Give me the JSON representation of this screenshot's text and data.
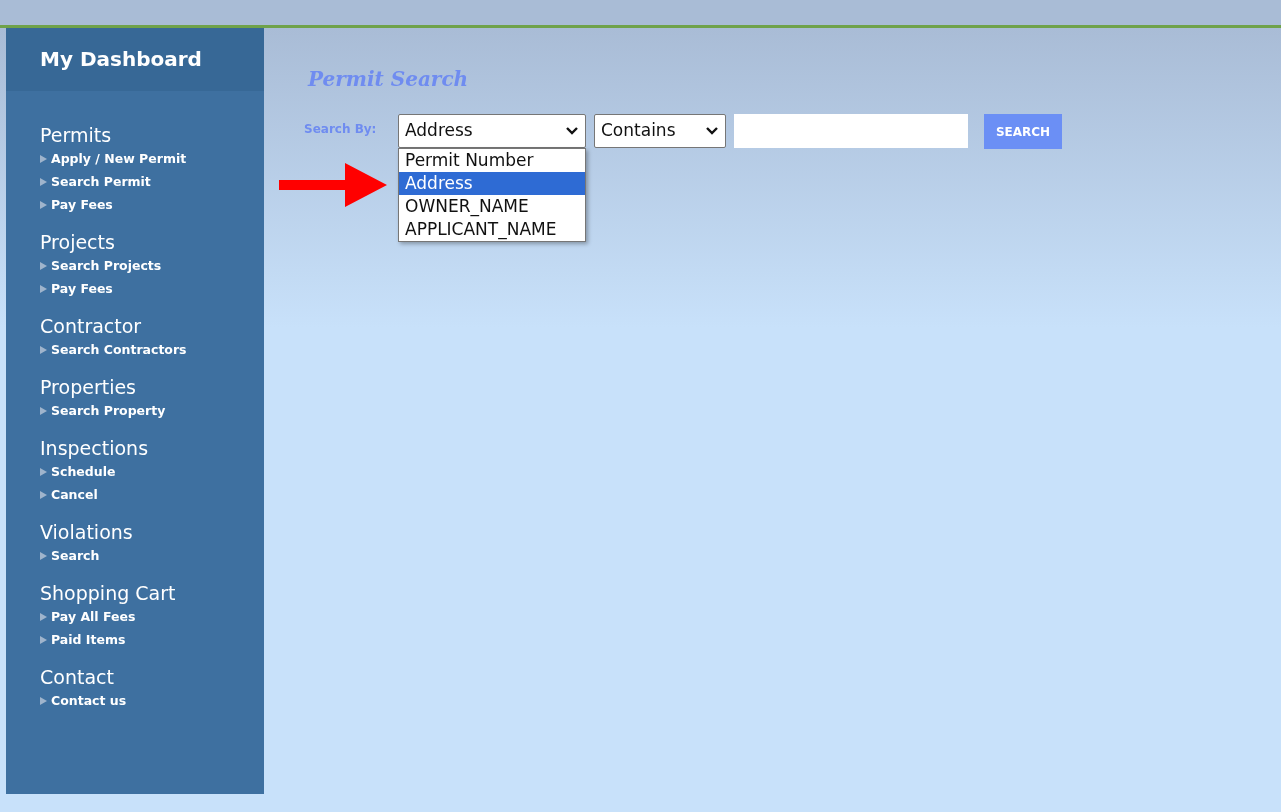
{
  "sidebar": {
    "title": "My Dashboard",
    "sections": [
      {
        "heading": "Permits",
        "items": [
          "Apply / New Permit",
          "Search Permit",
          "Pay Fees"
        ]
      },
      {
        "heading": "Projects",
        "items": [
          "Search Projects",
          "Pay Fees"
        ]
      },
      {
        "heading": "Contractor",
        "items": [
          "Search Contractors"
        ]
      },
      {
        "heading": "Properties",
        "items": [
          "Search Property"
        ]
      },
      {
        "heading": "Inspections",
        "items": [
          "Schedule",
          "Cancel"
        ]
      },
      {
        "heading": "Violations",
        "items": [
          "Search"
        ]
      },
      {
        "heading": "Shopping Cart",
        "items": [
          "Pay All Fees",
          "Paid Items"
        ]
      },
      {
        "heading": "Contact",
        "items": [
          "Contact us"
        ]
      }
    ]
  },
  "main": {
    "title": "Permit Search",
    "search_label": "Search By:",
    "field_select": {
      "value": "Address",
      "expanded": true,
      "options": [
        {
          "label": "Permit Number",
          "selected": false
        },
        {
          "label": "Address",
          "selected": true
        },
        {
          "label": "OWNER_NAME",
          "selected": false
        },
        {
          "label": "APPLICANT_NAME",
          "selected": false
        }
      ]
    },
    "match_select": {
      "value": "Contains"
    },
    "search_button": "SEARCH"
  }
}
